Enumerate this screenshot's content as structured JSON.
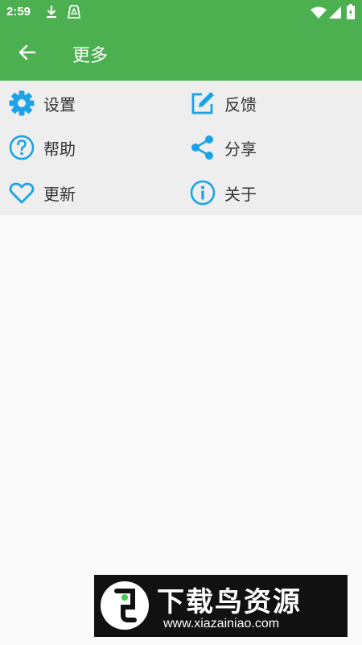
{
  "status_bar": {
    "time": "2:59",
    "icons": [
      "download-icon",
      "notification-icon",
      "wifi-icon",
      "signal-icon",
      "battery-icon"
    ]
  },
  "app_bar": {
    "title": "更多",
    "back_icon": "arrow-left-icon"
  },
  "menu": {
    "items": [
      {
        "label": "设置",
        "icon": "gear-icon"
      },
      {
        "label": "反馈",
        "icon": "edit-icon"
      },
      {
        "label": "帮助",
        "icon": "help-circle-icon"
      },
      {
        "label": "分享",
        "icon": "share-icon"
      },
      {
        "label": "更新",
        "icon": "heart-icon"
      },
      {
        "label": "关于",
        "icon": "info-circle-icon"
      }
    ]
  },
  "watermark": {
    "title": "下载鸟资源",
    "url": "www.xiazainiao.com"
  },
  "colors": {
    "app_bar": "#4caf50",
    "icon_accent": "#1aa3e8",
    "menu_background": "#eeeeee",
    "page_background": "#fafafa"
  }
}
